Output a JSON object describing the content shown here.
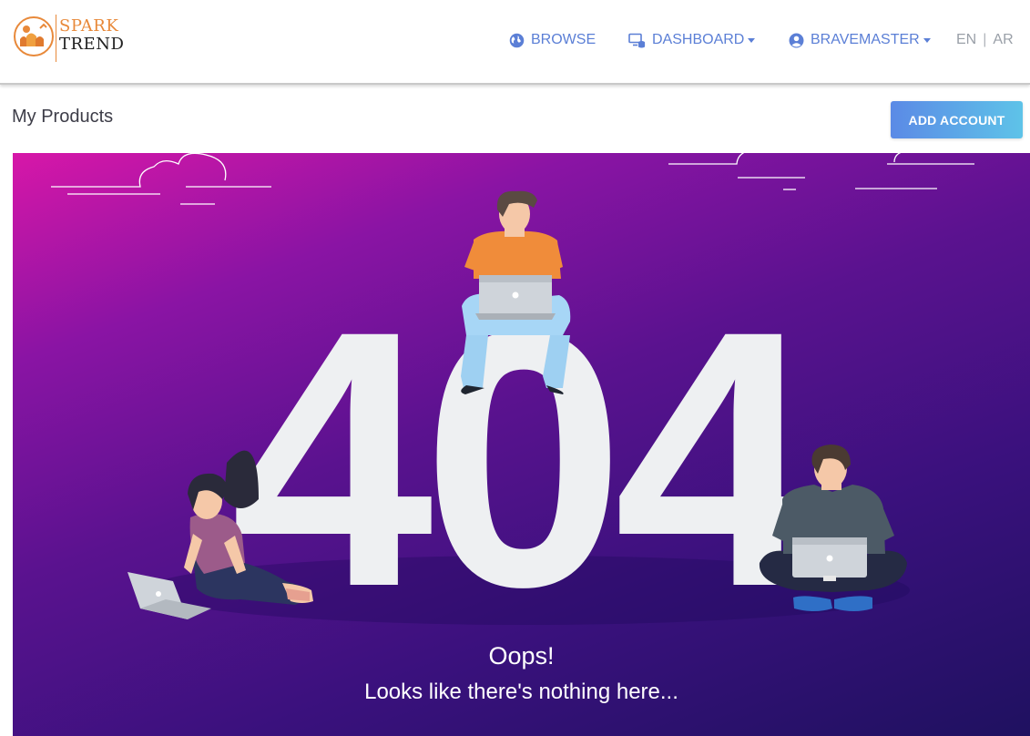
{
  "brand": {
    "line1": "SPARK",
    "line2": "TREND"
  },
  "nav": {
    "browse": {
      "label": "BROWSE",
      "icon": "globe-icon"
    },
    "dashboard": {
      "label": "DASHBOARD",
      "icon": "dashboard-icon"
    },
    "user": {
      "label": "BRAVEMASTER",
      "icon": "user-circle-icon"
    },
    "languages": [
      "EN",
      "AR"
    ]
  },
  "page": {
    "title": "My Products",
    "add_button": "ADD ACCOUNT"
  },
  "error": {
    "code": "404",
    "title": "Oops!",
    "message": "Looks like there's nothing here..."
  },
  "colors": {
    "accent": "#5b7fd6",
    "brand_orange": "#e8893a",
    "hero_start": "#d717a8",
    "hero_end": "#1f1160"
  }
}
